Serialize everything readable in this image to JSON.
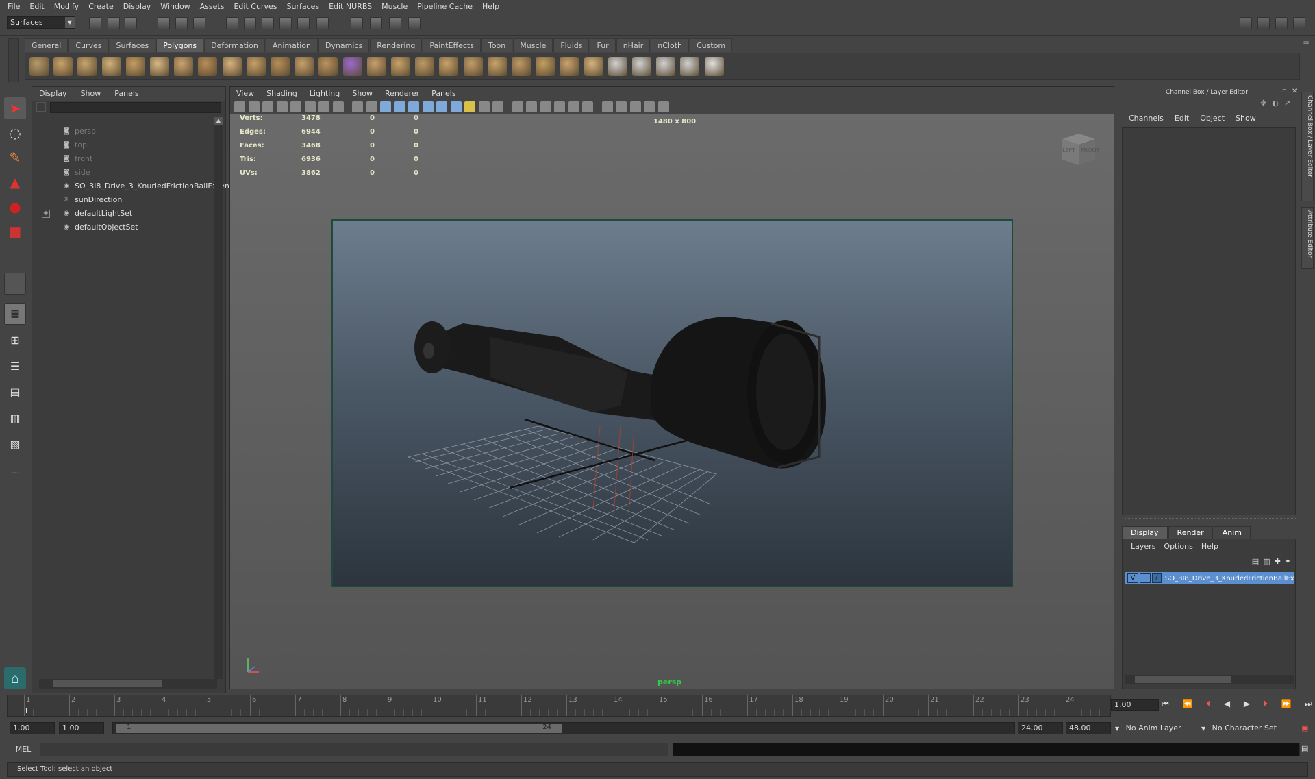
{
  "menubar": [
    "File",
    "Edit",
    "Modify",
    "Create",
    "Display",
    "Window",
    "Assets",
    "Edit Curves",
    "Surfaces",
    "Edit NURBS",
    "Muscle",
    "Pipeline Cache",
    "Help"
  ],
  "mode_selector": "Surfaces",
  "shelf_tabs": [
    "General",
    "Curves",
    "Surfaces",
    "Polygons",
    "Deformation",
    "Animation",
    "Dynamics",
    "Rendering",
    "PaintEffects",
    "Toon",
    "Muscle",
    "Fluids",
    "Fur",
    "nHair",
    "nCloth",
    "Custom"
  ],
  "active_shelf_tab": "Polygons",
  "outliner": {
    "menu": [
      "Display",
      "Show",
      "Panels"
    ],
    "items": [
      {
        "label": "persp",
        "dim": true
      },
      {
        "label": "top",
        "dim": true
      },
      {
        "label": "front",
        "dim": true
      },
      {
        "label": "side",
        "dim": true
      },
      {
        "label": "SO_3I8_Drive_3_KnurledFrictionBallExten",
        "dim": false
      },
      {
        "label": "sunDirection",
        "dim": false
      },
      {
        "label": "defaultLightSet",
        "dim": false
      },
      {
        "label": "defaultObjectSet",
        "dim": false
      }
    ]
  },
  "viewport": {
    "menu": [
      "View",
      "Shading",
      "Lighting",
      "Show",
      "Renderer",
      "Panels"
    ],
    "hud": {
      "rows": [
        {
          "label": "Verts:",
          "a": "3478",
          "b": "0",
          "c": "0"
        },
        {
          "label": "Edges:",
          "a": "6944",
          "b": "0",
          "c": "0"
        },
        {
          "label": "Faces:",
          "a": "3468",
          "b": "0",
          "c": "0"
        },
        {
          "label": "Tris:",
          "a": "6936",
          "b": "0",
          "c": "0"
        },
        {
          "label": "UVs:",
          "a": "3862",
          "b": "0",
          "c": "0"
        }
      ],
      "resolution": "1480 x 800"
    },
    "camera_label": "persp",
    "view_cube": {
      "left": "LEFT",
      "front": "FRONT"
    }
  },
  "channel_box": {
    "title": "Channel Box / Layer Editor",
    "menu": [
      "Channels",
      "Edit",
      "Object",
      "Show"
    ],
    "side_tabs": [
      "Channel Box / Layer Editor",
      "Attribute Editor"
    ],
    "layer_tabs": [
      "Display",
      "Render",
      "Anim"
    ],
    "active_layer_tab": "Display",
    "layer_menu": [
      "Layers",
      "Options",
      "Help"
    ],
    "layer": {
      "visible": "V",
      "name": "SO_3I8_Drive_3_KnurledFrictionBallEx"
    }
  },
  "timeline": {
    "ticks": [
      "1",
      "2",
      "3",
      "4",
      "5",
      "6",
      "7",
      "8",
      "9",
      "10",
      "11",
      "12",
      "13",
      "14",
      "15",
      "16",
      "17",
      "18",
      "19",
      "20",
      "21",
      "22",
      "23",
      "24"
    ],
    "current_frame_label": "1",
    "current_time": "1.00"
  },
  "range": {
    "start": "1.00",
    "start2": "1.00",
    "slider_start": "1",
    "slider_end": "24",
    "end": "24.00",
    "end2": "48.00",
    "anim_layer": "No Anim Layer",
    "character_set": "No Character Set"
  },
  "command_line": {
    "label": "MEL",
    "value": ""
  },
  "help_line": "Select Tool: select an object",
  "colors": {
    "accent": "#5b9bd5",
    "active_frame": "#1f4a3a"
  }
}
